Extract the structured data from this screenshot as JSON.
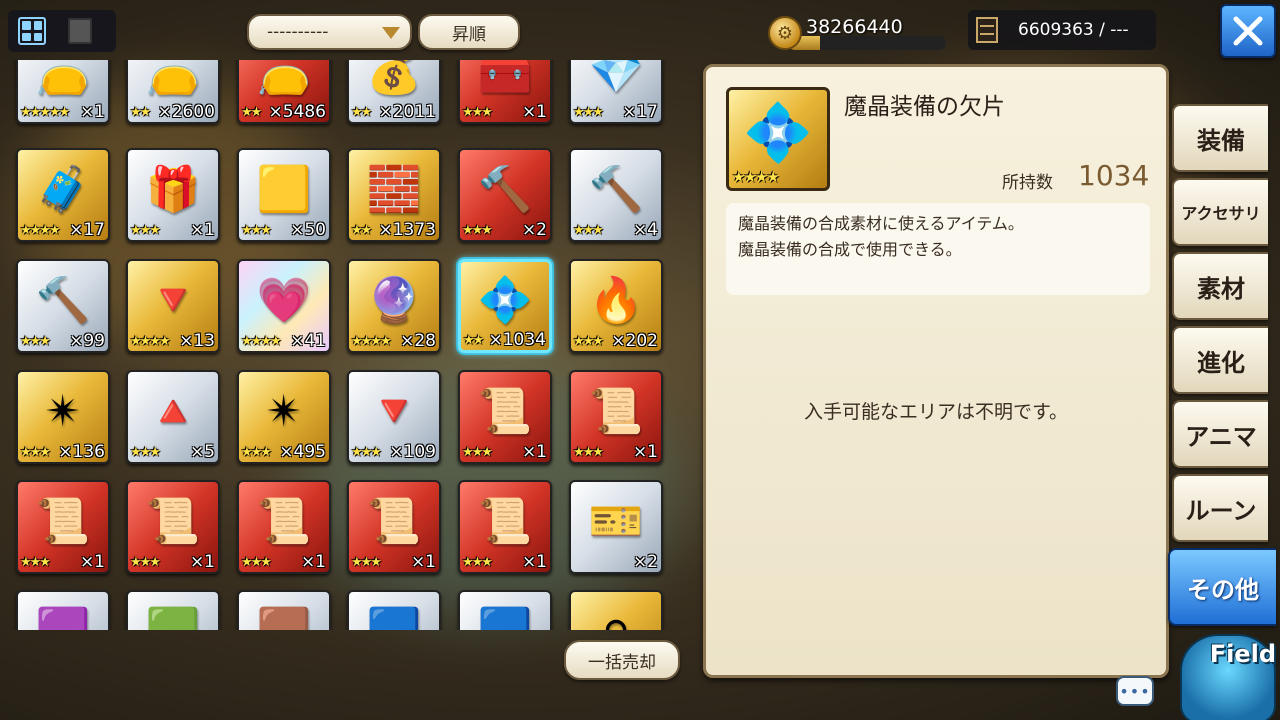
{
  "top_bar": {
    "sort_value": "----------",
    "order_label": "昇順",
    "gold_amount": "38266440",
    "gold_fill_fraction": 0.2,
    "material_count": "6609363 / ---"
  },
  "grid": {
    "items": [
      {
        "name": "pouch-brown",
        "bg": "silver",
        "art": "👝",
        "stars": "★★★★★",
        "count": "×1"
      },
      {
        "name": "pouch-silver",
        "bg": "silver",
        "art": "👝",
        "stars": "★★",
        "count": "×2600"
      },
      {
        "name": "pouch-red",
        "bg": "red",
        "art": "👝",
        "stars": "★★",
        "count": "×5486"
      },
      {
        "name": "pouch-gold",
        "bg": "silver",
        "art": "💰",
        "stars": "★★",
        "count": "×2011"
      },
      {
        "name": "iron-chest",
        "bg": "red",
        "art": "🧰",
        "stars": "★★★",
        "count": "×1"
      },
      {
        "name": "jewel-chest",
        "bg": "silver",
        "art": "💎",
        "stars": "★★★",
        "count": "×17"
      },
      {
        "name": "treasure-chest",
        "bg": "gold",
        "art": "🧳",
        "stars": "★★★★",
        "count": "×17"
      },
      {
        "name": "blue-gift-pouch",
        "bg": "silver",
        "art": "🎁",
        "stars": "★★★",
        "count": "×1"
      },
      {
        "name": "gold-ingots",
        "bg": "silver",
        "art": "🟨",
        "stars": "★★★",
        "count": "×50"
      },
      {
        "name": "gold-bars",
        "bg": "gold",
        "art": "🧱",
        "stars": "★★",
        "count": "×1373"
      },
      {
        "name": "war-hammer-red",
        "bg": "red",
        "art": "🔨",
        "stars": "★★★",
        "count": "×2"
      },
      {
        "name": "war-hammer-silver",
        "bg": "silver",
        "art": "🔨",
        "stars": "★★★",
        "count": "×4"
      },
      {
        "name": "war-hammer-blue",
        "bg": "silver",
        "art": "🔨",
        "stars": "★★★",
        "count": "×99"
      },
      {
        "name": "red-crystal",
        "bg": "gold",
        "art": "🔻",
        "stars": "★★★★",
        "count": "×13"
      },
      {
        "name": "pink-gem",
        "bg": "prism",
        "art": "💗",
        "stars": "★★★★",
        "count": "×41"
      },
      {
        "name": "pink-crystal",
        "bg": "gold",
        "art": "🔮",
        "stars": "★★★★",
        "count": "×28"
      },
      {
        "name": "blue-crystal-fragment",
        "bg": "gold",
        "art": "💠",
        "stars": "★★",
        "count": "×1034",
        "selected": true
      },
      {
        "name": "fire-egg",
        "bg": "gold",
        "art": "🔥",
        "stars": "★★★",
        "count": "×202"
      },
      {
        "name": "sun-emblem-gold",
        "bg": "gold",
        "art": "✴",
        "stars": "★★★",
        "count": "×136"
      },
      {
        "name": "triangle-emblem",
        "bg": "silver",
        "art": "🔺",
        "stars": "★★★",
        "count": "×5"
      },
      {
        "name": "sun-emblem-purple",
        "bg": "gold",
        "art": "✴",
        "stars": "★★★",
        "count": "×495"
      },
      {
        "name": "triangle-emblem-purple",
        "bg": "silver",
        "art": "🔻",
        "stars": "★★★",
        "count": "×109"
      },
      {
        "name": "scroll-silver-hair",
        "bg": "red",
        "art": "📜",
        "stars": "★★★",
        "count": "×1"
      },
      {
        "name": "scroll-grey-hair",
        "bg": "red",
        "art": "📜",
        "stars": "★★★",
        "count": "×1"
      },
      {
        "name": "scroll-green-orb",
        "bg": "red",
        "art": "📜",
        "stars": "★★★",
        "count": "×1"
      },
      {
        "name": "scroll-robot",
        "bg": "red",
        "art": "📜",
        "stars": "★★★",
        "count": "×1"
      },
      {
        "name": "scroll-raccoon",
        "bg": "red",
        "art": "📜",
        "stars": "★★★",
        "count": "×1"
      },
      {
        "name": "scroll-mech",
        "bg": "red",
        "art": "📜",
        "stars": "★★★",
        "count": "×1"
      },
      {
        "name": "scroll-hero",
        "bg": "red",
        "art": "📜",
        "stars": "★★★",
        "count": "×1"
      },
      {
        "name": "ticket",
        "bg": "silver",
        "art": "🎫",
        "stars": "",
        "count": "×2"
      },
      {
        "name": "card-purple",
        "bg": "silver",
        "art": "🟪",
        "stars": "",
        "count": ""
      },
      {
        "name": "card-teal",
        "bg": "silver",
        "art": "🟩",
        "stars": "",
        "count": ""
      },
      {
        "name": "card-pink",
        "bg": "silver",
        "art": "🟫",
        "stars": "",
        "count": ""
      },
      {
        "name": "card-blue",
        "bg": "silver",
        "art": "🟦",
        "stars": "",
        "count": ""
      },
      {
        "name": "card-light-blue",
        "bg": "silver",
        "art": "🟦",
        "stars": "",
        "count": ""
      },
      {
        "name": "round-silver",
        "bg": "gold",
        "art": "⚪",
        "stars": "",
        "count": ""
      }
    ]
  },
  "sell_all_label": "一括売却",
  "detail": {
    "name": "魔晶装備の欠片",
    "art": "💠",
    "stars": "★★★★",
    "owned_label": "所持数",
    "owned_value": "1034",
    "description": [
      "魔晶装備の合成素材に使えるアイテム。",
      "魔晶装備の合成で使用できる。"
    ],
    "area_text": "入手可能なエリアは不明です。"
  },
  "tabs": [
    {
      "label": "装備",
      "key": "equipment"
    },
    {
      "label": "アクセサリ",
      "key": "accessory",
      "small": true
    },
    {
      "label": "素材",
      "key": "material"
    },
    {
      "label": "進化",
      "key": "evolution"
    },
    {
      "label": "アニマ",
      "key": "anima"
    },
    {
      "label": "ルーン",
      "key": "rune"
    },
    {
      "label": "その他",
      "key": "other",
      "active": true
    }
  ],
  "field_label": "Field",
  "chat_label": "•••",
  "colors": {
    "accent_blue": "#1f6fd6",
    "selected_cyan": "#6fe8ff",
    "count_brown": "#7a5a30"
  }
}
